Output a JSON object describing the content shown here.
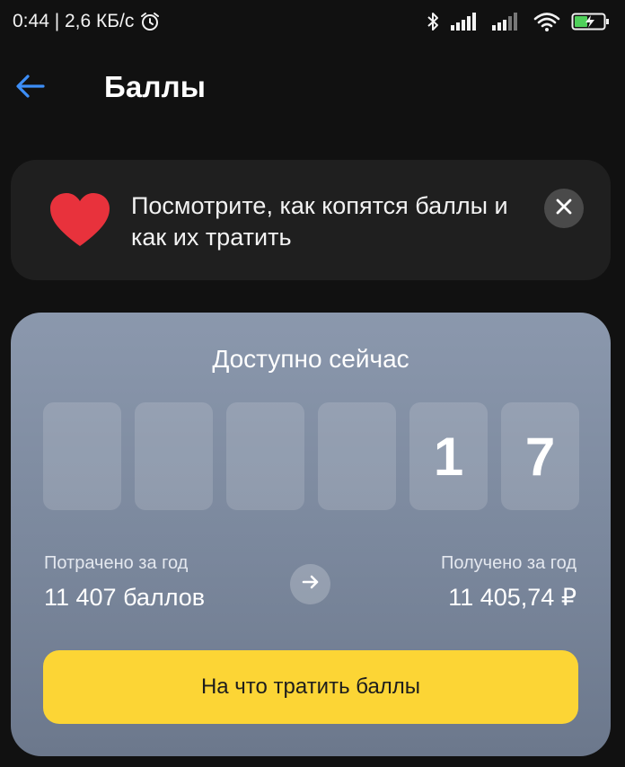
{
  "status_bar": {
    "time_speed": "0:44 | 2,6 КБ/с"
  },
  "app_bar": {
    "title": "Баллы"
  },
  "promo": {
    "text": "Посмотрите, как копятся баллы и как их тратить"
  },
  "points_card": {
    "title": "Доступно сейчас",
    "digits": [
      "",
      "",
      "",
      "",
      "1",
      "7"
    ],
    "spent_label": "Потрачено за год",
    "spent_value": "11 407 баллов",
    "earned_label": "Получено за год",
    "earned_value": "11 405,74 ₽",
    "button_label": "На что тратить баллы"
  },
  "colors": {
    "accent_blue": "#3d8ef7",
    "button_yellow": "#fcd535",
    "heart_red": "#e8323c",
    "card_top": "#8b98ad",
    "card_bottom": "#6c788c"
  },
  "icons": {
    "status": [
      "alarm-icon",
      "bluetooth-icon",
      "signal-icon",
      "signal-weak-icon",
      "wifi-icon",
      "battery-charging-icon"
    ],
    "back": "arrow-left-icon",
    "promo": "heart-icon",
    "close": "close-icon",
    "arrow": "arrow-right-icon"
  }
}
